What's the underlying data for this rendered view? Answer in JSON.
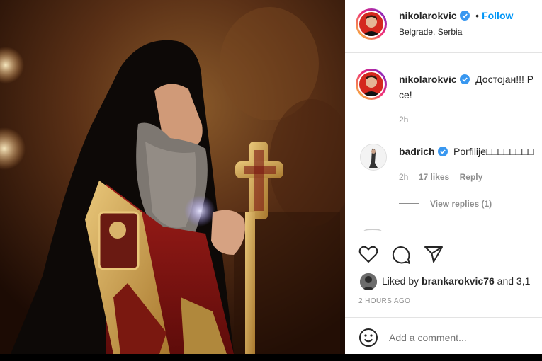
{
  "header": {
    "username": "nikolarokvic",
    "dot": "•",
    "follow_label": "Follow",
    "location": "Belgrade, Serbia"
  },
  "caption": {
    "username": "nikolarokvic",
    "text_line1": "Достојан!!! P",
    "text_line2": "се!",
    "time": "2h"
  },
  "comments": [
    {
      "username": "badrich",
      "text": "Porfilije□□□□□□□□",
      "time": "2h",
      "likes": "17 likes",
      "reply_label": "Reply",
      "view_replies": "View replies (1)"
    }
  ],
  "actions": {
    "liked_by_prefix": "Liked by",
    "liked_by_user": "brankarokvic76",
    "liked_by_suffix": "and 3,1",
    "timestamp": "2 HOURS AGO"
  },
  "add_comment": {
    "placeholder": "Add a comment..."
  },
  "colors": {
    "accent": "#0095f6",
    "verified": "#3897f0",
    "text": "#262626",
    "muted": "#8e8e8e"
  },
  "icons": [
    "heart-icon",
    "comment-icon",
    "share-icon",
    "verified-badge-icon",
    "emoji-icon"
  ]
}
